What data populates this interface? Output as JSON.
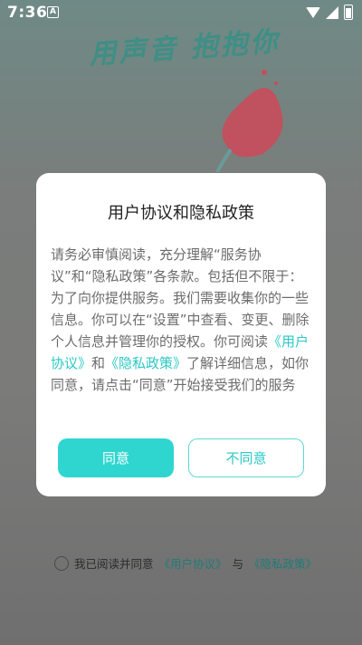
{
  "status_bar": {
    "time": "7:36",
    "notification_icon": "A"
  },
  "hero": {
    "title": "用声音 抱抱你"
  },
  "dialog": {
    "title": "用户协议和隐私政策",
    "body_part1": "请务必审慎阅读，充分理解“服务协议”和“隐私政策”各条款。包括但不限于：为了向你提供服务。我们需要收集你的一些信息。你可以在“设置”中查看、变更、删除个人信息并管理你的授权。你可阅读",
    "link_user_agreement": "《用户协议》",
    "and": "和",
    "link_privacy": "《隐私政策》",
    "body_part2": "了解详细信息，如你同意，请点击“同意”开始接受我们的服务",
    "agree_label": "同意",
    "disagree_label": "不同意"
  },
  "consent": {
    "prefix": "我已阅读并同意",
    "link_user_agreement": "《用户协议》",
    "and": "与",
    "link_privacy": "《隐私政策》"
  },
  "colors": {
    "accent": "#2fd6d0",
    "link": "#2bc8c5"
  }
}
